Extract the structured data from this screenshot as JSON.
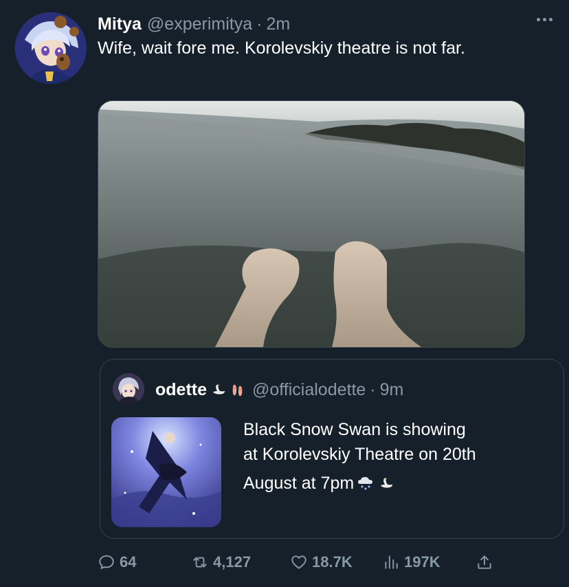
{
  "tweet": {
    "author_name": "Mitya",
    "author_handle": "@experimitya",
    "separator": "·",
    "time": "2m",
    "text": "Wife, wait fore me. Korolevskiy theatre is not far.",
    "avatar_icon": "user-avatar-icon",
    "more_icon": "more-dots-icon"
  },
  "quote": {
    "author_name": "odette",
    "name_emojis": [
      "swan-emoji-icon",
      "ballet-shoes-emoji-icon"
    ],
    "author_handle": "@officialodette",
    "separator": "·",
    "time": "9m",
    "text_lines": [
      "Black Snow Swan is showing",
      "at Korolevskiy Theatre on 20th",
      "August at 7pm"
    ],
    "text_emojis": [
      "snow-cloud-emoji-icon",
      "swan-emoji-icon"
    ]
  },
  "actions": {
    "reply_count": "64",
    "retweet_count": "4,127",
    "like_count": "18.7K",
    "views_count": "197K"
  },
  "colors": {
    "background": "#15202b",
    "border": "#38444d",
    "secondary_text": "#8899a6",
    "primary_text": "#ffffff"
  }
}
